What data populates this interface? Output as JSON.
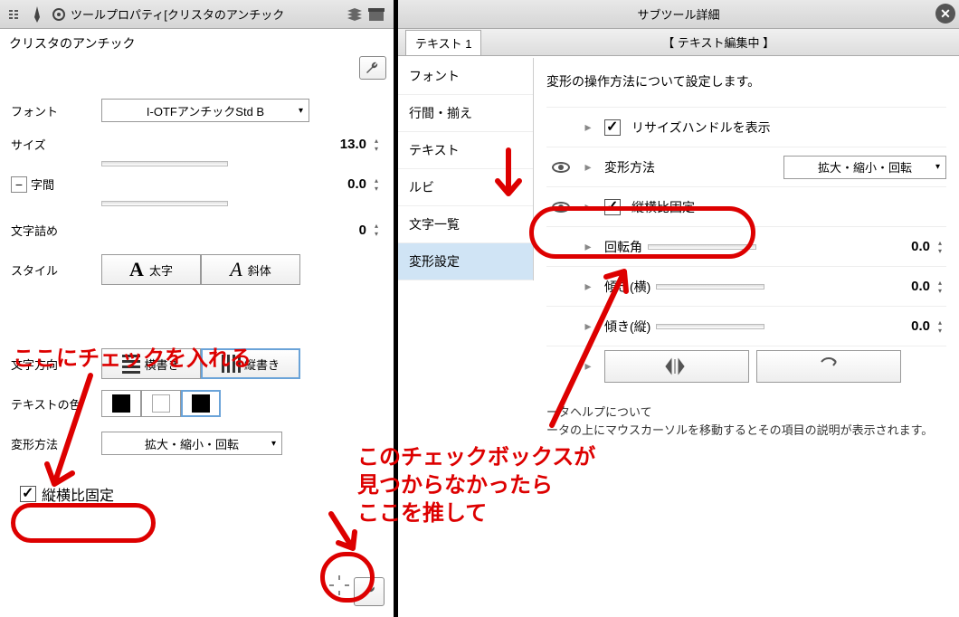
{
  "left": {
    "title": "ツールプロパティ[クリスタのアンチック",
    "toolName": "クリスタのアンチック",
    "font": {
      "label": "フォント",
      "value": "I-OTFアンチックStd B"
    },
    "size": {
      "label": "サイズ",
      "value": "13.0"
    },
    "tracking": {
      "label": "字間",
      "value": "0.0"
    },
    "tsume": {
      "label": "文字詰め",
      "value": "0"
    },
    "style": {
      "label": "スタイル",
      "bold": "太字",
      "italic": "斜体"
    },
    "direction": {
      "label": "文字方向",
      "h": "横書き",
      "v": "縦書き"
    },
    "textColor": {
      "label": "テキストの色"
    },
    "transform": {
      "label": "変形方法",
      "value": "拡大・縮小・回転"
    },
    "keepRatio": "縦横比固定"
  },
  "right": {
    "title": "サブツール詳細",
    "tab": "テキスト 1",
    "editing": "【 テキスト編集中 】",
    "cats": [
      "フォント",
      "行間・揃え",
      "テキスト",
      "ルビ",
      "文字一覧",
      "変形設定"
    ],
    "desc": "変形の操作方法について設定します。",
    "resizeHandle": "リサイズハンドルを表示",
    "method": {
      "label": "変形方法",
      "value": "拡大・縮小・回転"
    },
    "keepRatio": "縦横比固定",
    "rotation": {
      "label": "回転角",
      "value": "0.0"
    },
    "skewH": {
      "label": "傾き(横)",
      "value": "0.0"
    },
    "skewV": {
      "label": "傾き(縦)",
      "value": "0.0"
    },
    "help1": "ータヘルプについて",
    "help2": "ータの上にマウスカーソルを移動するとその項目の説明が表示されます。"
  },
  "annot": {
    "a1": "ここにチェックを入れる",
    "a2": "このチェックボックスが\n見つからなかったら\nここを推して"
  }
}
